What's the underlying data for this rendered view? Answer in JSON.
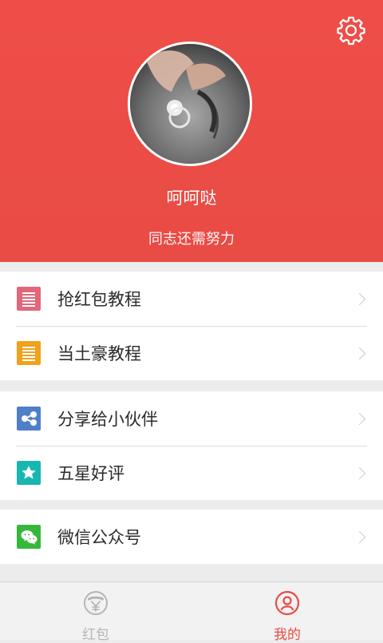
{
  "profile": {
    "nickname": "呵呵哒",
    "motto": "同志还需努力"
  },
  "menu_groups": [
    [
      {
        "label": "抢红包教程",
        "icon": "document-list-icon",
        "color": "#e2677a"
      },
      {
        "label": "当土豪教程",
        "icon": "document-list-icon",
        "color": "#f0a21c"
      }
    ],
    [
      {
        "label": "分享给小伙伴",
        "icon": "share-icon",
        "color": "#4f7fc7"
      },
      {
        "label": "五星好评",
        "icon": "star-icon",
        "color": "#17b7b0"
      }
    ],
    [
      {
        "label": "微信公众号",
        "icon": "wechat-icon",
        "color": "#35b83a"
      }
    ]
  ],
  "tabs": [
    {
      "label": "红包",
      "icon": "red-packet-yen-icon",
      "active": false,
      "color": "#b5b5b5"
    },
    {
      "label": "我的",
      "icon": "profile-icon",
      "active": true,
      "color": "#e94a44"
    }
  ],
  "colors": {
    "header": "#eb4c46",
    "accent": "#e94a44"
  }
}
